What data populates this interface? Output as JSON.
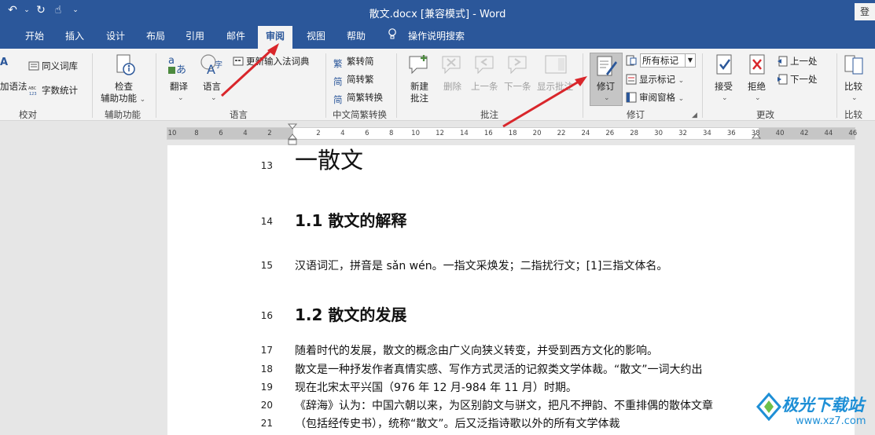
{
  "window": {
    "title": "散文.docx [兼容模式] - Word",
    "login": "登"
  },
  "qat": {
    "undo": "↶",
    "undo_arrow": "⌄",
    "redo": "↻",
    "touch": "☝",
    "customize": "⌄"
  },
  "tabs": [
    {
      "label": "开始"
    },
    {
      "label": "插入"
    },
    {
      "label": "设计"
    },
    {
      "label": "布局"
    },
    {
      "label": "引用"
    },
    {
      "label": "邮件"
    },
    {
      "label": "审阅"
    },
    {
      "label": "视图"
    },
    {
      "label": "帮助"
    },
    {
      "label": "操作说明搜索"
    }
  ],
  "ribbon": {
    "proofing": {
      "grammar": "加语法",
      "thesaurus": "同义词库",
      "wordcount": "字数统计",
      "group": "校对"
    },
    "accessibility": {
      "check_line1": "检查",
      "check_line2": "辅助功能",
      "group": "辅助功能"
    },
    "language": {
      "translate": "翻译",
      "language": "语言",
      "ime_dict": "更新输入法词典",
      "group": "语言"
    },
    "chinese": {
      "to_simplified": "繁转简",
      "to_traditional": "简转繁",
      "convert": "简繁转换",
      "group": "中文简繁转换"
    },
    "comments": {
      "new_line1": "新建",
      "new_line2": "批注",
      "delete": "删除",
      "prev": "上一条",
      "next": "下一条",
      "show": "显示批注",
      "group": "批注"
    },
    "tracking": {
      "track": "修订",
      "markup_select": "所有标记",
      "show_markup": "显示标记",
      "review_pane": "审阅窗格",
      "group": "修订"
    },
    "changes": {
      "accept": "接受",
      "reject": "拒绝",
      "previous": "上一处",
      "next": "下一处",
      "group": "更改"
    },
    "compare": {
      "compare": "比较",
      "group": "比较"
    }
  },
  "ruler": {
    "ticks": [
      "10",
      "8",
      "6",
      "4",
      "2",
      "2",
      "4",
      "6",
      "8",
      "10",
      "12",
      "14",
      "16",
      "18",
      "20",
      "22",
      "24",
      "26",
      "28",
      "30",
      "32",
      "34",
      "36",
      "38",
      "40",
      "42",
      "44",
      "46"
    ]
  },
  "document": {
    "lines": [
      {
        "num": "13",
        "text": "一散文",
        "style": "h1"
      },
      {
        "num": "14",
        "text": "1.1 散文的解释",
        "style": "h2"
      },
      {
        "num": "15",
        "text": "汉语词汇，拼音是 sǎn wén。一指文采焕发；二指扰行文；[1]三指文体名。",
        "style": "body"
      },
      {
        "num": "16",
        "text": "1.2 散文的发展",
        "style": "h2"
      },
      {
        "num": "17",
        "text": "随着时代的发展，散文的概念由广义向狭义转变，并受到西方文化的影响。",
        "style": "body"
      },
      {
        "num": "18",
        "text": "散文是一种抒发作者真情实感、写作方式灵活的记叙类文学体裁。“散文”一词大约出",
        "style": "body"
      },
      {
        "num": "19",
        "text": "现在北宋太平兴国（976 年 12 月-984 年 11 月）时期。",
        "style": "body"
      },
      {
        "num": "20",
        "text": "《辞海》认为：中国六朝以来，为区别韵文与骈文，把凡不押韵、不重排偶的散体文章",
        "style": "body"
      },
      {
        "num": "21",
        "text": "（包括经传史书），统称“散文”。后又泛指诗歌以外的所有文学体裁",
        "style": "body"
      },
      {
        "num": "22",
        "text": "",
        "style": "body"
      }
    ]
  },
  "watermark": {
    "name": "极光下载站",
    "url": "www.xz7.com"
  },
  "colors": {
    "word_blue": "#2b579a",
    "arrow_red": "#d9262b",
    "watermark_blue": "#1e8fd6"
  }
}
